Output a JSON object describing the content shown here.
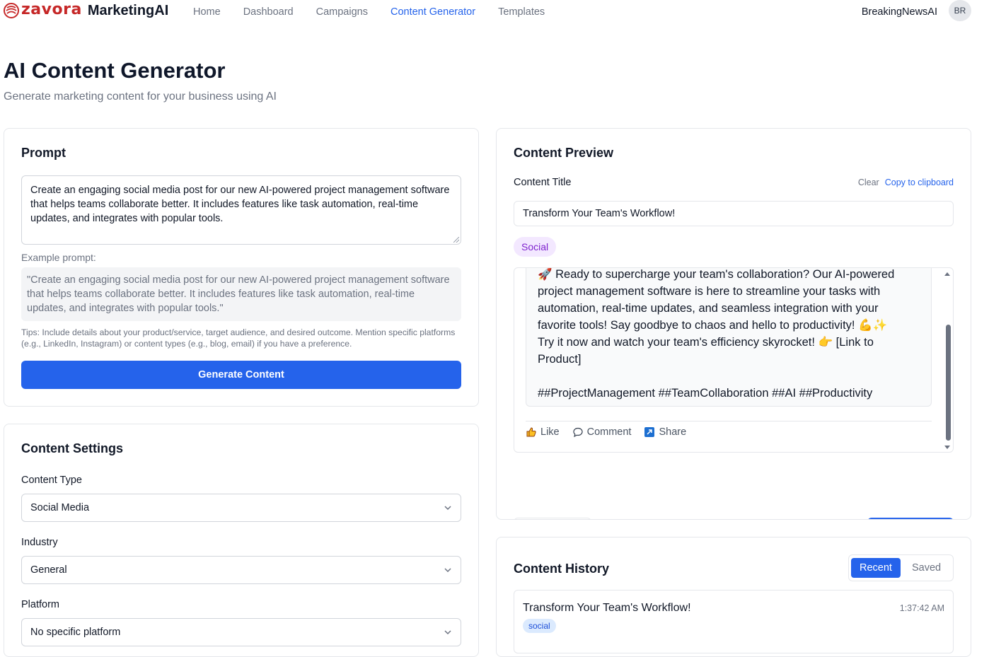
{
  "nav": {
    "logo_word": "zavora",
    "app_name": "MarketingAI",
    "links": [
      "Home",
      "Dashboard",
      "Campaigns",
      "Content Generator",
      "Templates"
    ],
    "active_link": "Content Generator",
    "user_name": "BreakingNewsAI",
    "avatar_initials": "BR"
  },
  "page": {
    "title": "AI Content Generator",
    "subtitle": "Generate marketing content for your business using AI"
  },
  "prompt": {
    "title": "Prompt",
    "value": "Create an engaging social media post for our new AI-powered project management software that helps teams collaborate better. It includes features like task automation, real-time updates, and integrates with popular tools.",
    "example_label": "Example prompt:",
    "example_text": "\"Create an engaging social media post for our new AI-powered project management software that helps teams collaborate better. It includes features like task automation, real-time updates, and integrates with popular tools.\"",
    "tips": "Tips: Include details about your product/service, target audience, and desired outcome. Mention specific platforms (e.g., LinkedIn, Instagram) or content types (e.g., blog, email) if you have a preference.",
    "generate_label": "Generate Content"
  },
  "settings": {
    "title": "Content Settings",
    "content_type_label": "Content Type",
    "content_type_value": "Social Media",
    "industry_label": "Industry",
    "industry_value": "General",
    "platform_label": "Platform",
    "platform_value": "No specific platform"
  },
  "preview": {
    "title": "Content Preview",
    "content_title_label": "Content Title",
    "clear_label": "Clear",
    "copy_label": "Copy to clipboard",
    "content_title_value": "Transform Your Team's Workflow!",
    "type_badge": "Social",
    "post_line1": "🚀 Ready to supercharge your team's collaboration? Our AI-powered",
    "post_line2": "project management software is here to streamline your tasks with",
    "post_line3": "automation, real-time updates, and seamless integration with your",
    "post_line4": "favorite tools! Say goodbye to chaos and hello to productivity! 💪✨",
    "post_line5": "Try it now and watch your team's efficiency skyrocket! 👉 [Link to",
    "post_line6": "Product]",
    "post_hashtags": "##ProjectManagement ##TeamCollaboration ##AI ##Productivity",
    "like_label": "Like",
    "comment_label": "Comment",
    "share_label": "Share"
  },
  "history": {
    "title": "Content History",
    "tab_recent": "Recent",
    "tab_saved": "Saved",
    "items": [
      {
        "title": "Transform Your Team's Workflow!",
        "time": "1:37:42 AM",
        "tag": "social"
      }
    ]
  },
  "colors": {
    "accent": "#2563eb",
    "brand_red": "#c62828",
    "badge_purple_bg": "#f3e8ff",
    "badge_purple_text": "#7e22ce"
  }
}
